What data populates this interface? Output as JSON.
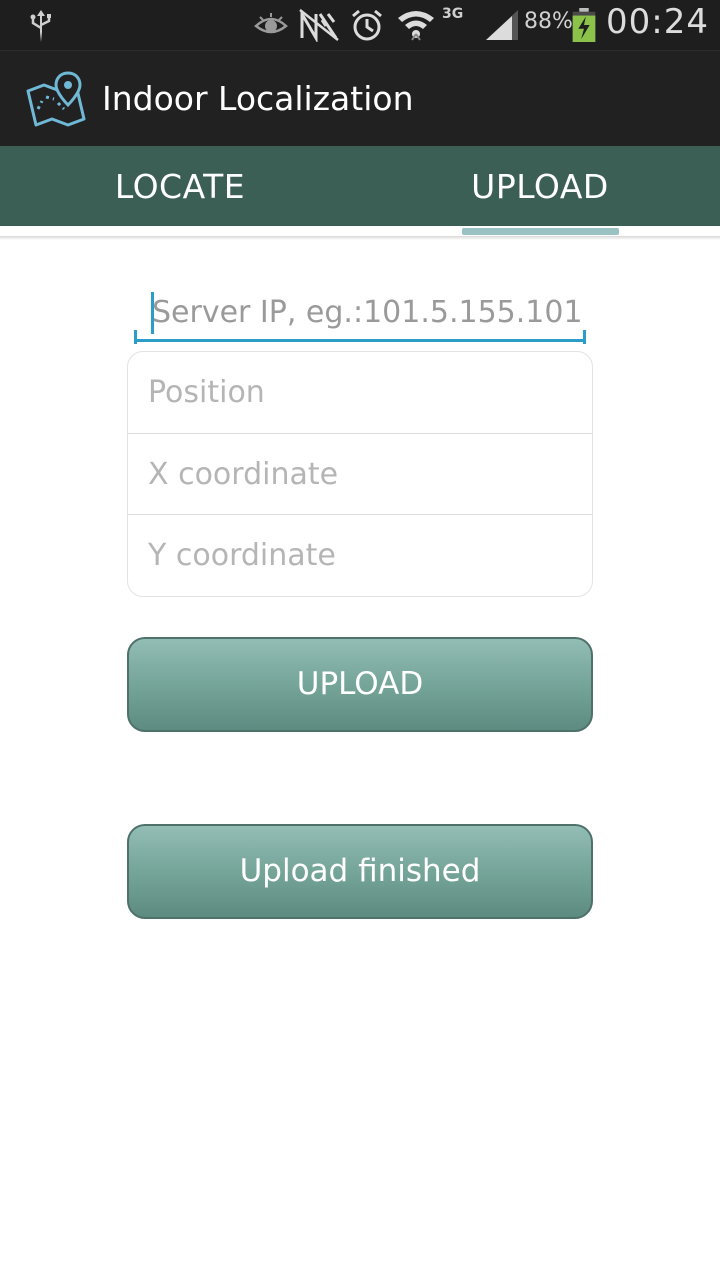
{
  "status_bar": {
    "icons": [
      "usb-icon",
      "eye-icon",
      "no-signal-icon",
      "alarm-icon",
      "wifi-icon",
      "signal-icon",
      "battery-charging-icon"
    ],
    "network_type": "3G",
    "battery_percent": "88%",
    "time": "00:24"
  },
  "action_bar": {
    "title": "Indoor Localization",
    "logo_icon": "map-pin-icon"
  },
  "tabs": [
    {
      "label": "LOCATE",
      "selected": false
    },
    {
      "label": "UPLOAD",
      "selected": true
    }
  ],
  "form": {
    "server_ip": {
      "value": "",
      "placeholder": "Server IP, eg.:101.5.155.101"
    },
    "position": {
      "value": "",
      "placeholder": "Position"
    },
    "x_coordinate": {
      "value": "",
      "placeholder": "X coordinate"
    },
    "y_coordinate": {
      "value": "",
      "placeholder": "Y coordinate"
    }
  },
  "buttons": {
    "upload": "UPLOAD",
    "status": "Upload finished"
  },
  "colors": {
    "tab_bar": "#3b5e55",
    "accent": "#2a9ec8",
    "button_top": "#93bdb5",
    "button_bottom": "#5d8b80"
  }
}
